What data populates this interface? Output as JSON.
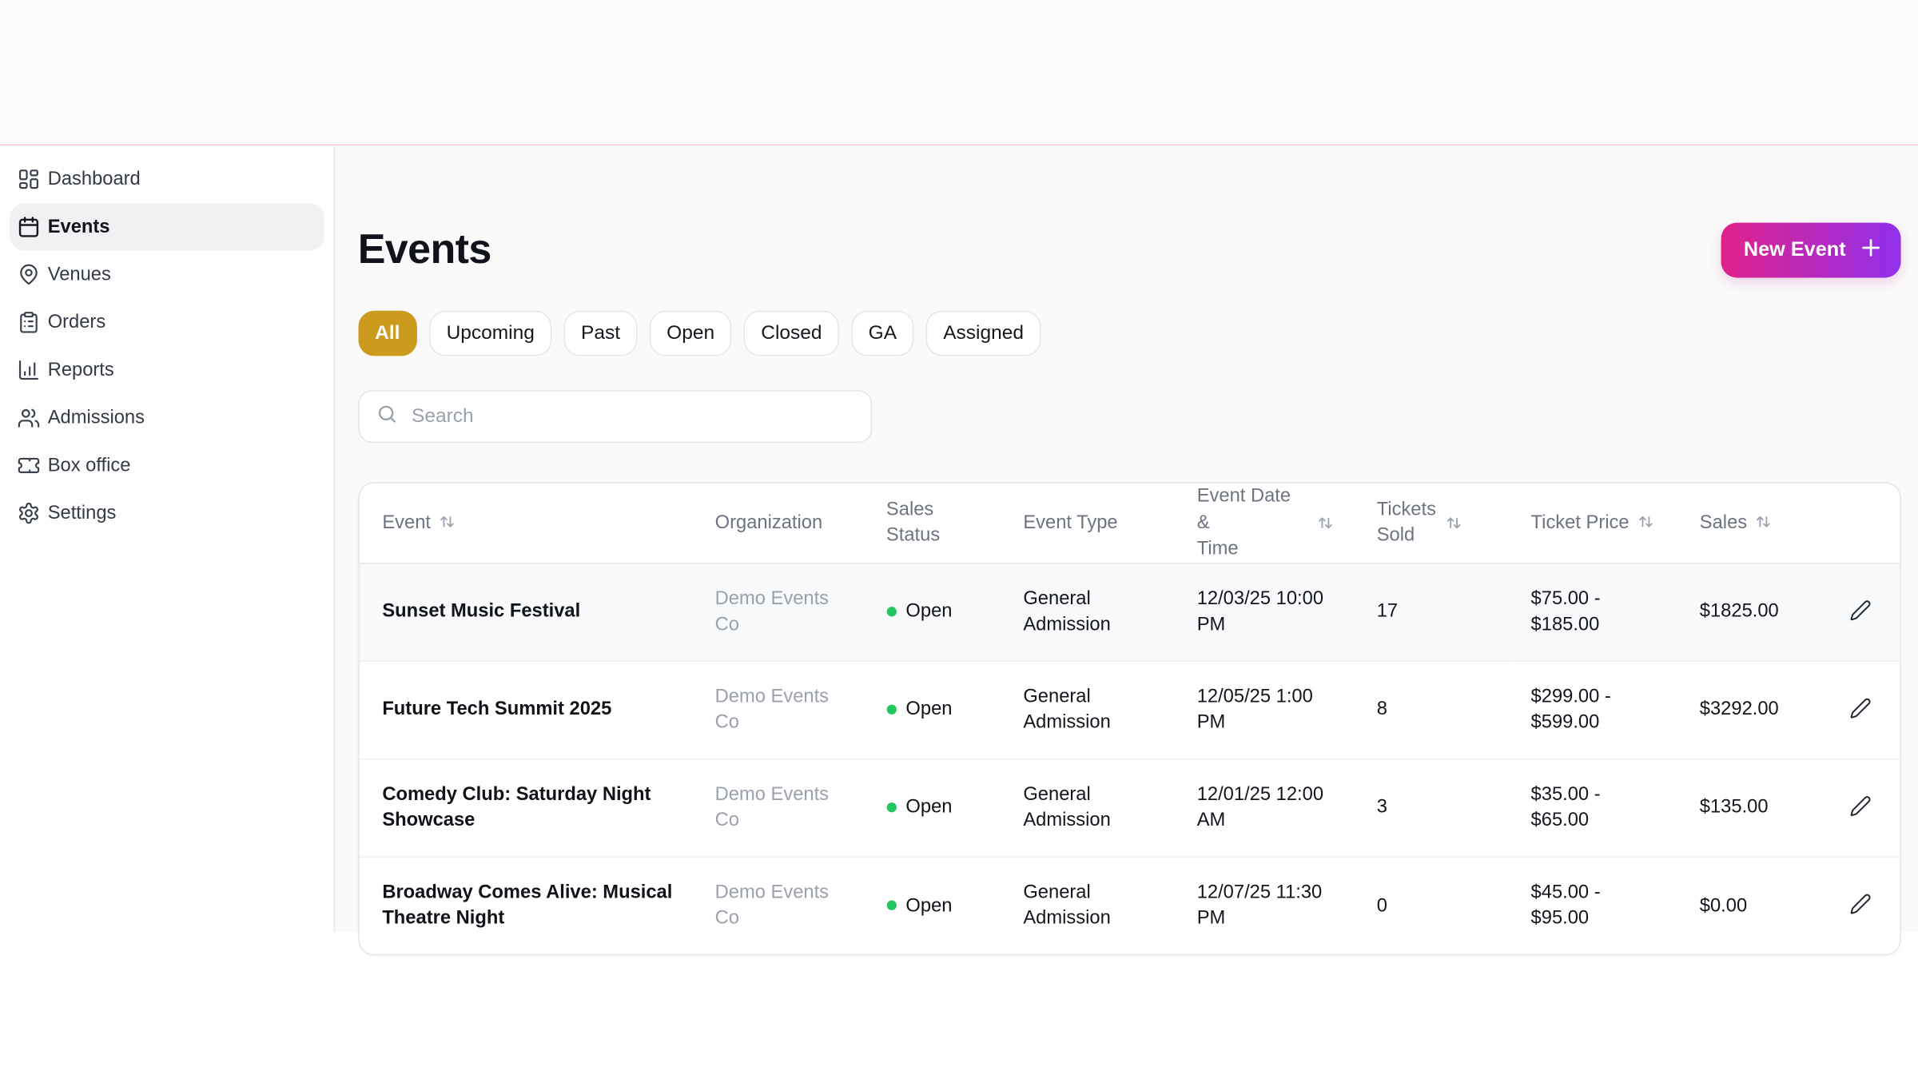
{
  "colors": {
    "top_line": "#f1cdcd",
    "gold_active_filter": "#cc9a1d",
    "gradient_from": "#e0218a",
    "gradient_to": "#9030ec",
    "status_open_green": "#22c55e"
  },
  "sidebar": {
    "items": [
      {
        "label": "Dashboard",
        "icon": "layout-dashboard-icon",
        "active": false
      },
      {
        "label": "Events",
        "icon": "calendar-icon",
        "active": true
      },
      {
        "label": "Venues",
        "icon": "map-pin-icon",
        "active": false
      },
      {
        "label": "Orders",
        "icon": "clipboard-list-icon",
        "active": false
      },
      {
        "label": "Reports",
        "icon": "chart-column-icon",
        "active": false
      },
      {
        "label": "Admissions",
        "icon": "users-icon",
        "active": false
      },
      {
        "label": "Box office",
        "icon": "ticket-icon",
        "active": false
      },
      {
        "label": "Settings",
        "icon": "gear-icon",
        "active": false
      }
    ]
  },
  "header": {
    "title": "Events",
    "new_event_label": "New Event",
    "new_event_icon": "plus-icon"
  },
  "filters": {
    "items": [
      {
        "label": "All",
        "active": true
      },
      {
        "label": "Upcoming",
        "active": false
      },
      {
        "label": "Past",
        "active": false
      },
      {
        "label": "Open",
        "active": false
      },
      {
        "label": "Closed",
        "active": false
      },
      {
        "label": "GA",
        "active": false
      },
      {
        "label": "Assigned",
        "active": false
      }
    ]
  },
  "search": {
    "placeholder": "Search"
  },
  "table": {
    "columns": [
      {
        "key": "event",
        "label": "Event",
        "sortable": true,
        "icon_mode": "inline"
      },
      {
        "key": "organization",
        "label": "Organization",
        "sortable": false
      },
      {
        "key": "sales_status",
        "label": "Sales Status",
        "sortable": false,
        "label_lines": [
          "Sales",
          "Status"
        ]
      },
      {
        "key": "event_type",
        "label": "Event Type",
        "sortable": false
      },
      {
        "key": "datetime",
        "label": "Event Date & Time",
        "sortable": true,
        "icon_mode": "side",
        "label_lines": [
          "Event Date &",
          "Time"
        ]
      },
      {
        "key": "tickets_sold",
        "label": "Tickets Sold",
        "sortable": true,
        "icon_mode": "side",
        "label_lines": [
          "Tickets",
          "Sold"
        ]
      },
      {
        "key": "ticket_price",
        "label": "Ticket Price",
        "sortable": true,
        "icon_mode": "inline"
      },
      {
        "key": "sales",
        "label": "Sales",
        "sortable": true,
        "icon_mode": "inline"
      },
      {
        "key": "actions",
        "label": "",
        "sortable": false,
        "row_icon": "pencil-icon"
      }
    ],
    "rows": [
      {
        "event": "Sunset Music Festival",
        "organization": "Demo Events Co",
        "sales_status": "Open",
        "event_type": "General Admission",
        "datetime": "12/03/25 10:00 PM",
        "tickets_sold": "17",
        "ticket_price": "$75.00 - $185.00",
        "sales": "$1825.00",
        "highlighted": true
      },
      {
        "event": "Future Tech Summit 2025",
        "organization": "Demo Events Co",
        "sales_status": "Open",
        "event_type": "General Admission",
        "datetime": "12/05/25 1:00 PM",
        "tickets_sold": "8",
        "ticket_price": "$299.00 - $599.00",
        "sales": "$3292.00",
        "highlighted": false
      },
      {
        "event": "Comedy Club: Saturday Night Showcase",
        "organization": "Demo Events Co",
        "sales_status": "Open",
        "event_type": "General Admission",
        "datetime": "12/01/25 12:00 AM",
        "tickets_sold": "3",
        "ticket_price": "$35.00 - $65.00",
        "sales": "$135.00",
        "highlighted": false
      },
      {
        "event": "Broadway Comes Alive: Musical Theatre Night",
        "organization": "Demo Events Co",
        "sales_status": "Open",
        "event_type": "General Admission",
        "datetime": "12/07/25 11:30 PM",
        "tickets_sold": "0",
        "ticket_price": "$45.00 - $95.00",
        "sales": "$0.00",
        "highlighted": false
      }
    ]
  }
}
